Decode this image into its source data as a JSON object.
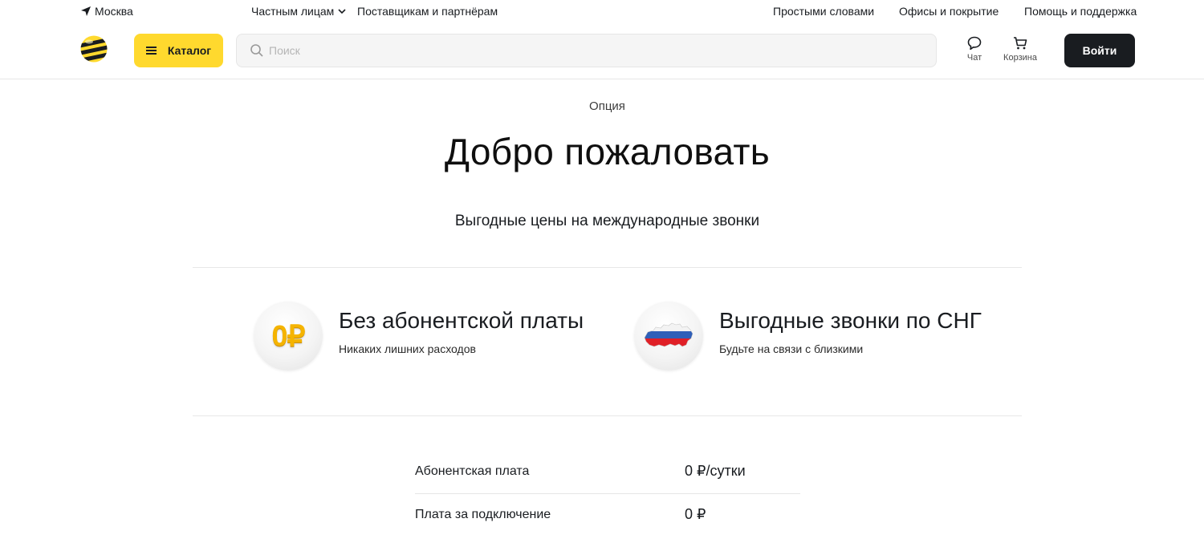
{
  "topbar": {
    "city": "Москва",
    "nav_private": "Частным лицам",
    "nav_partners": "Поставщикам и партнёрам",
    "nav_simple": "Простыми словами",
    "nav_offices": "Офисы и покрытие",
    "nav_help": "Помощь и поддержка"
  },
  "header": {
    "catalog_label": "Каталог",
    "search_placeholder": "Поиск",
    "chat_label": "Чат",
    "cart_label": "Корзина",
    "login_label": "Войти"
  },
  "hero": {
    "eyebrow": "Опция",
    "title": "Добро пожаловать",
    "subtitle": "Выгодные цены на международные звонки"
  },
  "features": [
    {
      "icon": "zero-ruble-coin-icon",
      "icon_text": "0₽",
      "title": "Без абонентской платы",
      "description": "Никаких лишних расходов"
    },
    {
      "icon": "russia-map-icon",
      "title": "Выгодные звонки по СНГ",
      "description": "Будьте на связи с близкими"
    }
  ],
  "prices": [
    {
      "label": "Абонентская плата",
      "value": "0 ₽/сутки"
    },
    {
      "label": "Плата за подключение",
      "value": "0 ₽"
    }
  ],
  "colors": {
    "brand_yellow": "#ffd92e",
    "dark": "#191c20",
    "divider": "#e6e6e6"
  }
}
